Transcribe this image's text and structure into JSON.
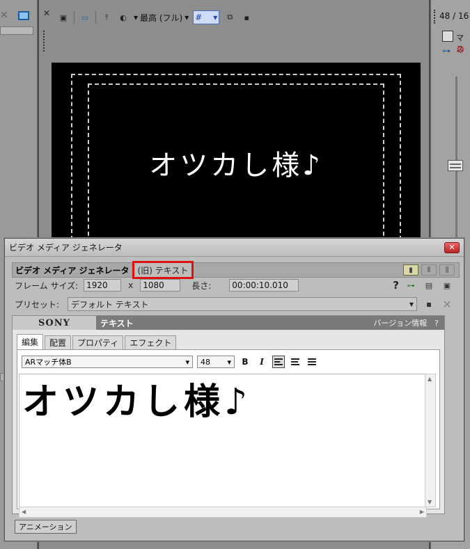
{
  "preview": {
    "quality_label": "最高 (フル)",
    "overlay_text": "オツカし様♪"
  },
  "right_panel": {
    "frame_count": "48 / 16",
    "mask_label": "マス"
  },
  "dialog": {
    "window_title": "ビデオ メディア ジェネレータ",
    "generator_name": "ビデオ メディア ジェネレータ",
    "media_type": "(旧) テキスト",
    "frame_size_label": "フレーム サイズ:",
    "width": "1920",
    "x_sep": "x",
    "height": "1080",
    "length_label": "長さ:",
    "length": "00:00:10.010",
    "preset_label": "プリセット:",
    "preset_value": "デフォルト テキスト",
    "help": "?",
    "plugin": {
      "brand": "SONY",
      "name": "テキスト",
      "version": "バージョン情報　?"
    },
    "tabs": [
      "編集",
      "配置",
      "プロパティ",
      "エフェクト"
    ],
    "font_name": "ARマッチ体B",
    "font_size": "48",
    "bold_label": "B",
    "italic_label": "I",
    "editor_text": "オツカし様♪",
    "animation_button": "アニメーション"
  },
  "colors": {
    "highlight": "#e01010",
    "background": "#4a4a4a",
    "dialog": "#bdbdbd"
  }
}
